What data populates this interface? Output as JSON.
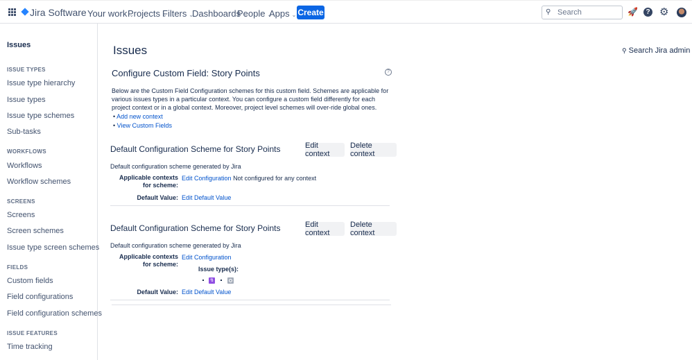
{
  "topbar": {
    "brand": "Jira Software",
    "nav": [
      "Your work",
      "Projects",
      "Filters",
      "Dashboards",
      "People",
      "Apps"
    ],
    "create": "Create",
    "search_placeholder": "Search"
  },
  "sidebar": {
    "title": "Issues",
    "sections": [
      {
        "heading": "ISSUE TYPES",
        "items": [
          "Issue type hierarchy",
          "Issue types",
          "Issue type schemes",
          "Sub-tasks"
        ]
      },
      {
        "heading": "WORKFLOWS",
        "items": [
          "Workflows",
          "Workflow schemes"
        ]
      },
      {
        "heading": "SCREENS",
        "items": [
          "Screens",
          "Screen schemes",
          "Issue type screen schemes"
        ]
      },
      {
        "heading": "FIELDS",
        "items": [
          "Custom fields",
          "Field configurations",
          "Field configuration schemes"
        ]
      },
      {
        "heading": "ISSUE FEATURES",
        "items": [
          "Time tracking"
        ]
      }
    ]
  },
  "main": {
    "title": "Issues",
    "search_admin": "Search Jira admin",
    "heading": "Configure Custom Field: Story Points",
    "description": "Below are the Custom Field Configuration schemes for this custom field. Schemes are applicable for various issues types in a particular context. You can configure a custom field differently for each project context or in a global context. Moreover, project level schemes will over-ride global ones.",
    "links": [
      "Add new context",
      "View Custom Fields"
    ],
    "schemes": [
      {
        "title": "Default Configuration Scheme for Story Points",
        "edit": "Edit context",
        "delete": "Delete context",
        "desc": "Default configuration scheme generated by Jira",
        "contexts_label": "Applicable contexts for scheme:",
        "edit_config": "Edit Configuration",
        "contexts_value": "Not configured for any context",
        "default_label": "Default Value:",
        "edit_default": "Edit Default Value"
      },
      {
        "title": "Default Configuration Scheme for Story Points",
        "edit": "Edit context",
        "delete": "Delete context",
        "desc": "Default configuration scheme generated by Jira",
        "contexts_label": "Applicable contexts for scheme:",
        "edit_config": "Edit Configuration",
        "issue_types_label": "Issue type(s):",
        "default_label": "Default Value:",
        "edit_default": "Edit Default Value"
      }
    ]
  },
  "colors": {
    "primary": "#0c66e4",
    "link": "#0052cc",
    "epic": "#904ee2",
    "subtask_gray": "#a5adba"
  }
}
